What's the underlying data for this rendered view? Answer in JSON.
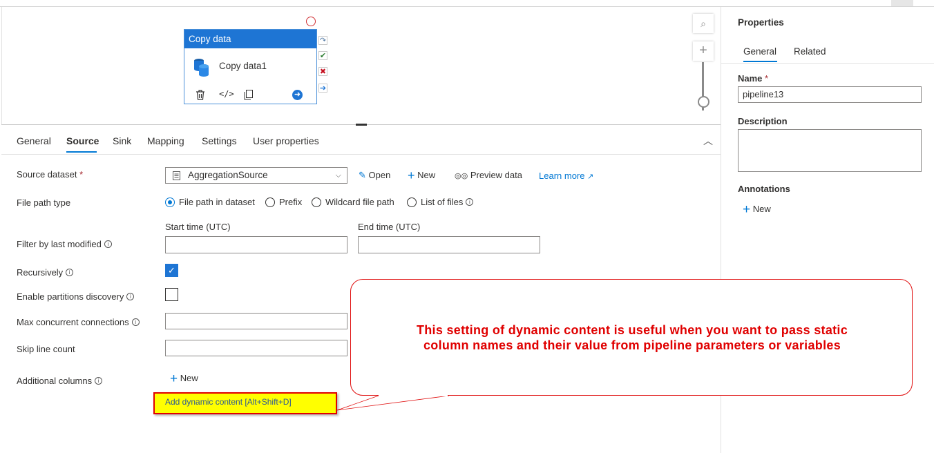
{
  "canvas": {
    "activity": {
      "type_label": "Copy data",
      "name": "Copy data1"
    },
    "icons": [
      "database-icon",
      "delete-icon",
      "code-icon",
      "copy-icon",
      "run-arrow-icon",
      "search-icon",
      "plus-icon"
    ]
  },
  "tabs": [
    {
      "label": "General"
    },
    {
      "label": "Source"
    },
    {
      "label": "Sink"
    },
    {
      "label": "Mapping"
    },
    {
      "label": "Settings"
    },
    {
      "label": "User properties"
    }
  ],
  "source": {
    "dataset_label": "Source dataset",
    "required_mark": "*",
    "dataset_value": "AggregationSource",
    "open_label": "Open",
    "new_label": "New",
    "preview_label": "Preview data",
    "learn_more_label": "Learn more",
    "file_path_type_label": "File path type",
    "file_path_options": [
      "File path in dataset",
      "Prefix",
      "Wildcard file path",
      "List of files"
    ],
    "file_path_selected": "File path in dataset",
    "start_time_label": "Start time (UTC)",
    "end_time_label": "End time (UTC)",
    "filter_label": "Filter by last modified",
    "recursively_label": "Recursively",
    "recursively_checked": true,
    "partitions_label": "Enable partitions discovery",
    "partitions_checked": false,
    "max_conn_label": "Max concurrent connections",
    "skip_label": "Skip line count",
    "additional_label": "Additional columns",
    "add_new_label": "New",
    "dynamic_content_label": "Add dynamic content [Alt+Shift+D]"
  },
  "properties": {
    "title": "Properties",
    "tabs": [
      "General",
      "Related"
    ],
    "name_label": "Name",
    "name_value": "pipeline13",
    "description_label": "Description",
    "annotations_label": "Annotations",
    "new_label": "New"
  },
  "callout": {
    "line1": "This setting of dynamic content is useful when you want to pass static",
    "line2": "column names and their value from pipeline parameters or variables"
  },
  "colors": {
    "accent": "#0078d4",
    "activity_header": "#1e75d4",
    "callout_text": "#e00000",
    "highlight": "#ffff00"
  }
}
